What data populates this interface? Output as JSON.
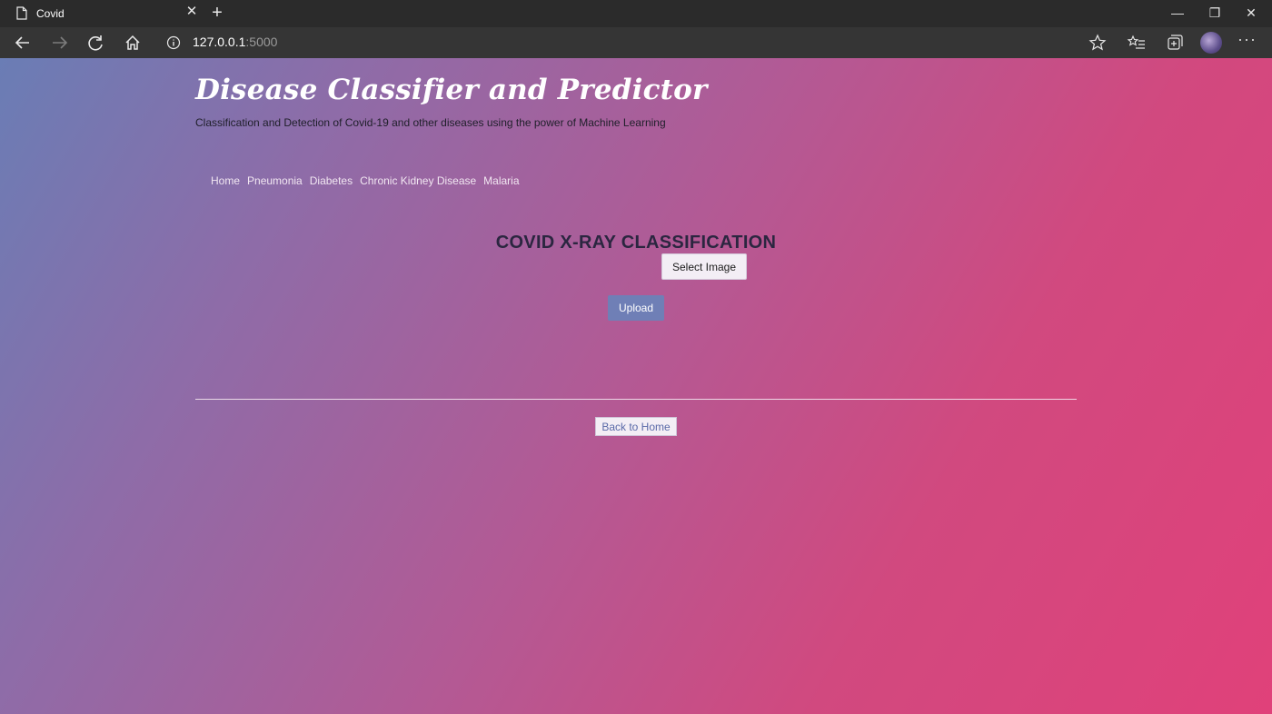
{
  "browser": {
    "tab_title": "Covid",
    "tab_close": "✕",
    "new_tab": "+",
    "address_host": "127.0.0.1",
    "address_port": ":5000",
    "window_controls": {
      "minimize": "—",
      "restore": "❐",
      "close": "✕"
    },
    "more_menu": "···"
  },
  "header": {
    "title": "Disease Classifier and Predictor",
    "subtitle": "Classification and Detection of Covid-19 and other diseases using the power of Machine Learning"
  },
  "nav": {
    "items": [
      {
        "label": "Home"
      },
      {
        "label": "Pneumonia"
      },
      {
        "label": "Diabetes"
      },
      {
        "label": "Chronic Kidney Disease"
      },
      {
        "label": "Malaria"
      }
    ]
  },
  "main": {
    "title": "COVID X-RAY CLASSIFICATION",
    "select_label": "Select Image",
    "upload_label": "Upload",
    "back_label": "Back to Home"
  },
  "colors": {
    "gradient_start": "#6a7db5",
    "gradient_end": "#e0417a",
    "upload_button": "#6f7fb6"
  }
}
